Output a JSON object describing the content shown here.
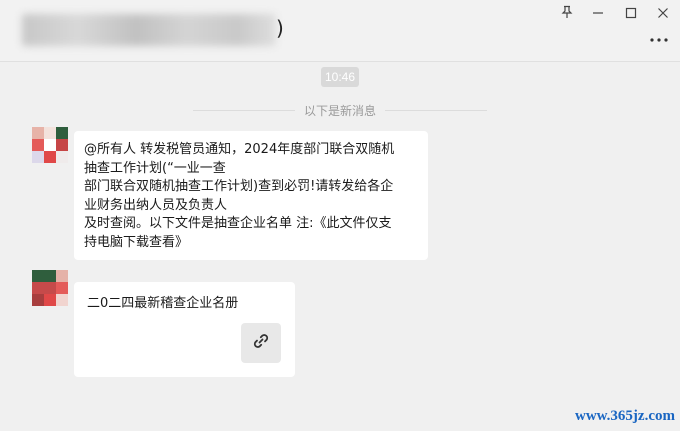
{
  "chat": {
    "title_suffix": ")",
    "time": "10:46",
    "new_messages_label": "以下是新消息",
    "messages": [
      {
        "text": "@所有人 转发税管员通知，2024年度部门联合双随机\n抽查工作计划(“一业一查\n部门联合双随机抽查工作计划)查到必罚!请转发给各企\n业财务出纳人员及负责人\n及时查阅。以下文件是抽查企业名单 注:《此文件仅支\n持电脑下载查看》"
      },
      {
        "filename": "二0二四最新稽查企业名册",
        "link_icon": "link-icon"
      }
    ]
  },
  "window_controls": [
    "pin-icon",
    "minimize-icon",
    "maximize-icon",
    "close-icon"
  ],
  "more_icon": "more-icon",
  "watermark": "www.365jz.com",
  "colors": {
    "background": "#f0f0f0",
    "bubble": "#ffffff",
    "time_badge": "#d9d9d9",
    "watermark": "#1a66c2"
  }
}
